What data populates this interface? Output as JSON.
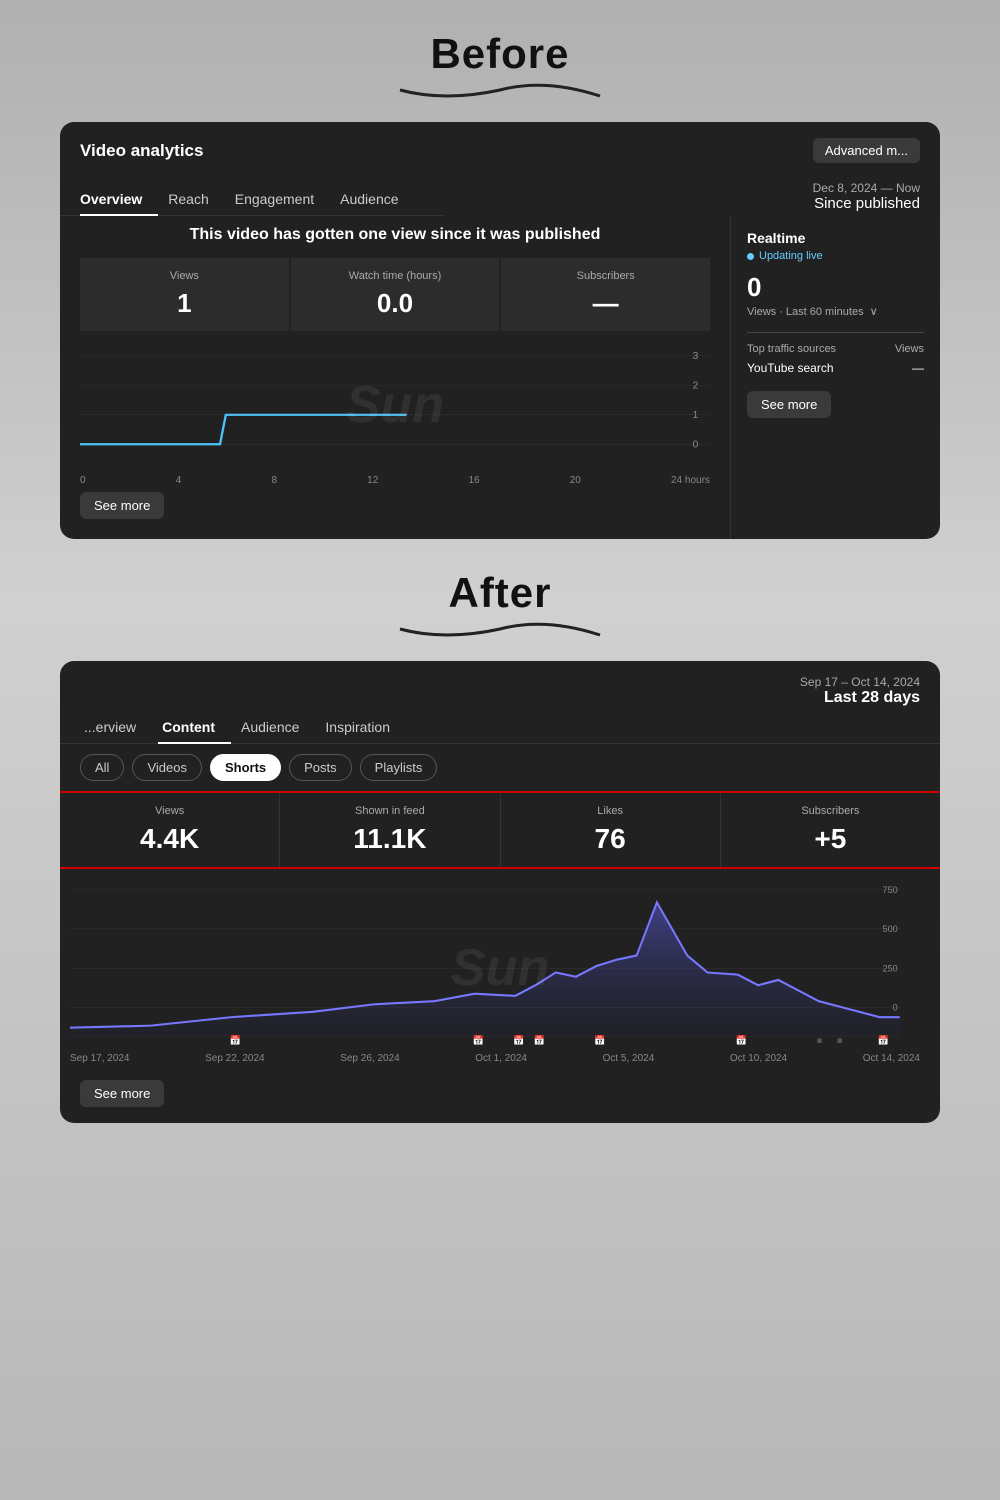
{
  "page": {
    "before_label": "Before",
    "after_label": "After"
  },
  "before": {
    "title": "Video analytics",
    "advanced_btn": "Advanced m...",
    "tabs": [
      "Overview",
      "Reach",
      "Engagement",
      "Audience"
    ],
    "active_tab": "Overview",
    "date_line1": "Dec 8, 2024 — Now",
    "date_line2": "Since published",
    "headline": "This video has gotten one view since it was published",
    "stats": [
      {
        "label": "Views",
        "value": "1"
      },
      {
        "label": "Watch time (hours)",
        "value": "0.0"
      },
      {
        "label": "Subscribers",
        "value": "—"
      }
    ],
    "chart_watermark": "Sun",
    "x_labels": [
      "0",
      "4",
      "8",
      "12",
      "16",
      "20",
      "24 hours"
    ],
    "y_labels": [
      "3",
      "2",
      "1",
      "0"
    ],
    "see_more_btn": "See more",
    "sidebar": {
      "realtime_title": "Realtime",
      "realtime_status": "Updating live",
      "views_count": "0",
      "views_label": "Views · Last 60 minutes",
      "traffic_title": "Top traffic sources",
      "traffic_col": "Views",
      "traffic_rows": [
        {
          "source": "YouTube search",
          "views": "—"
        }
      ],
      "see_more_btn": "See more"
    }
  },
  "after": {
    "main_tabs": [
      "...erview",
      "Content",
      "Audience",
      "Inspiration"
    ],
    "active_main_tab": "Content",
    "date_line1": "Sep 17 – Oct 14, 2024",
    "date_line2": "Last 28 days",
    "sub_tabs": [
      "All",
      "Videos",
      "Shorts",
      "Posts",
      "Playlists"
    ],
    "active_sub_tab": "Shorts",
    "stats": [
      {
        "label": "Views",
        "value": "4.4K"
      },
      {
        "label": "Shown in feed",
        "value": "11.1K"
      },
      {
        "label": "Likes",
        "value": "76"
      },
      {
        "label": "Subscribers",
        "value": "+5"
      }
    ],
    "chart_watermark": "Sun",
    "x_labels": [
      "Sep 17, 2024",
      "Sep 22, 2024",
      "Sep 26, 2024",
      "Oct 1, 2024",
      "Oct 5, 2024",
      "Oct 10, 2024",
      "Oct 14, 2024"
    ],
    "y_labels": [
      "750",
      "500",
      "250",
      "0"
    ],
    "see_more_btn": "See more"
  }
}
